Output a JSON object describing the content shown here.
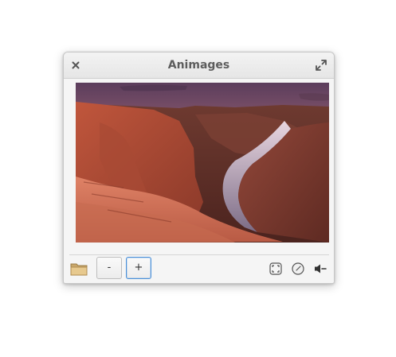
{
  "window": {
    "title": "Animages"
  },
  "titlebar": {
    "close_icon": "close-icon",
    "maximize_icon": "maximize-icon"
  },
  "viewer": {
    "image_subject": "canyon-river-photo"
  },
  "toolbar": {
    "open_icon": "folder-icon",
    "zoom_out_label": "-",
    "zoom_in_label": "+",
    "fit_icon": "fit-to-window-icon",
    "timer_icon": "clock-icon",
    "audio_icon": "speaker-mute-icon"
  },
  "colors": {
    "accent": "#4a90d9",
    "titlebar": "#ececec",
    "window_bg": "#f5f5f5"
  }
}
